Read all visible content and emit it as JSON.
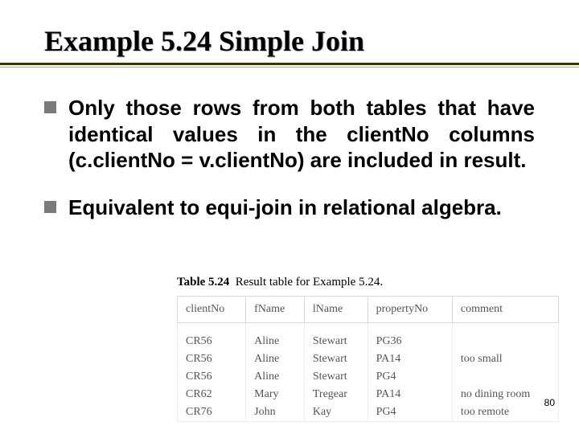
{
  "title": "Example 5.24  Simple Join",
  "bullets": [
    "Only those rows from both tables that have identical values in the clientNo columns (c.clientNo = v.clientNo) are included in result.",
    "Equivalent to equi-join in relational algebra."
  ],
  "table": {
    "caption_bold": "Table 5.24",
    "caption_rest": "Result table for Example 5.24.",
    "columns": [
      "clientNo",
      "fName",
      "lName",
      "propertyNo",
      "comment"
    ],
    "rows": [
      [
        "CR56",
        "Aline",
        "Stewart",
        "PG36",
        ""
      ],
      [
        "CR56",
        "Aline",
        "Stewart",
        "PA14",
        "too small"
      ],
      [
        "CR56",
        "Aline",
        "Stewart",
        "PG4",
        ""
      ],
      [
        "CR62",
        "Mary",
        "Tregear",
        "PA14",
        "no dining room"
      ],
      [
        "CR76",
        "John",
        "Kay",
        "PG4",
        "too remote"
      ]
    ]
  },
  "page_number": "80"
}
